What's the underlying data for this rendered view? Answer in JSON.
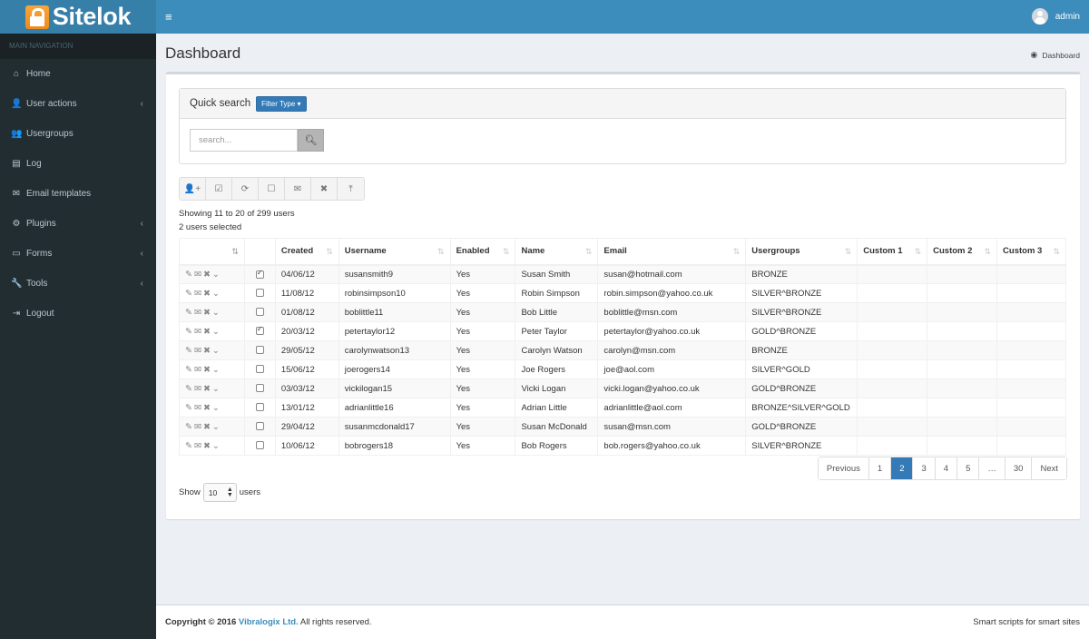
{
  "app": {
    "logo_text": "Sitelok",
    "user": "admin"
  },
  "sidebar": {
    "header": "MAIN NAVIGATION",
    "items": [
      {
        "label": "Home",
        "icon": "home-icon",
        "glyph": "⌂",
        "chevron": false
      },
      {
        "label": "User actions",
        "icon": "user-icon",
        "glyph": "👤",
        "chevron": true
      },
      {
        "label": "Usergroups",
        "icon": "users-icon",
        "glyph": "👥",
        "chevron": false
      },
      {
        "label": "Log",
        "icon": "list-icon",
        "glyph": "▤",
        "chevron": false
      },
      {
        "label": "Email templates",
        "icon": "envelope-icon",
        "glyph": "✉",
        "chevron": false
      },
      {
        "label": "Plugins",
        "icon": "plug-icon",
        "glyph": "⚙",
        "chevron": true
      },
      {
        "label": "Forms",
        "icon": "form-icon",
        "glyph": "▭",
        "chevron": true
      },
      {
        "label": "Tools",
        "icon": "wrench-icon",
        "glyph": "🔧",
        "chevron": true
      },
      {
        "label": "Logout",
        "icon": "logout-icon",
        "glyph": "⇥",
        "chevron": false
      }
    ],
    "chevron_glyph": "‹"
  },
  "page": {
    "title": "Dashboard",
    "breadcrumb": "Dashboard"
  },
  "quick_search": {
    "title": "Quick search",
    "filter_label": "Filter Type ▾",
    "placeholder": "search..."
  },
  "toolbar": [
    {
      "name": "add-user-button",
      "icon": "add-user-icon",
      "glyph": "👤+"
    },
    {
      "name": "select-all-button",
      "icon": "check-square-icon",
      "glyph": "☑"
    },
    {
      "name": "refresh-button",
      "icon": "refresh-icon",
      "glyph": "⟳"
    },
    {
      "name": "deselect-button",
      "icon": "square-icon",
      "glyph": "☐"
    },
    {
      "name": "email-button",
      "icon": "envelope-icon",
      "glyph": "✉"
    },
    {
      "name": "delete-button",
      "icon": "close-icon",
      "glyph": "✖"
    },
    {
      "name": "export-button",
      "icon": "export-icon",
      "glyph": "⤒"
    }
  ],
  "status": {
    "showing": "Showing 11 to 20 of 299 users",
    "selected": "2 users selected"
  },
  "table": {
    "columns": [
      "",
      "",
      "Created",
      "Username",
      "Enabled",
      "Name",
      "Email",
      "Usergroups",
      "Custom 1",
      "Custom 2",
      "Custom 3"
    ],
    "rows": [
      {
        "checked": true,
        "created": "04/06/12",
        "username": "susansmith9",
        "enabled": "Yes",
        "name": "Susan Smith",
        "email": "susan@hotmail.com",
        "groups": "BRONZE",
        "c1": "",
        "c2": "",
        "c3": ""
      },
      {
        "checked": false,
        "created": "11/08/12",
        "username": "robinsimpson10",
        "enabled": "Yes",
        "name": "Robin Simpson",
        "email": "robin.simpson@yahoo.co.uk",
        "groups": "SILVER^BRONZE",
        "c1": "",
        "c2": "",
        "c3": ""
      },
      {
        "checked": false,
        "created": "01/08/12",
        "username": "boblittle11",
        "enabled": "Yes",
        "name": "Bob Little",
        "email": "boblittle@msn.com",
        "groups": "SILVER^BRONZE",
        "c1": "",
        "c2": "",
        "c3": ""
      },
      {
        "checked": true,
        "created": "20/03/12",
        "username": "petertaylor12",
        "enabled": "Yes",
        "name": "Peter Taylor",
        "email": "petertaylor@yahoo.co.uk",
        "groups": "GOLD^BRONZE",
        "c1": "",
        "c2": "",
        "c3": ""
      },
      {
        "checked": false,
        "created": "29/05/12",
        "username": "carolynwatson13",
        "enabled": "Yes",
        "name": "Carolyn Watson",
        "email": "carolyn@msn.com",
        "groups": "BRONZE",
        "c1": "",
        "c2": "",
        "c3": ""
      },
      {
        "checked": false,
        "created": "15/06/12",
        "username": "joerogers14",
        "enabled": "Yes",
        "name": "Joe Rogers",
        "email": "joe@aol.com",
        "groups": "SILVER^GOLD",
        "c1": "",
        "c2": "",
        "c3": ""
      },
      {
        "checked": false,
        "created": "03/03/12",
        "username": "vickilogan15",
        "enabled": "Yes",
        "name": "Vicki Logan",
        "email": "vicki.logan@yahoo.co.uk",
        "groups": "GOLD^BRONZE",
        "c1": "",
        "c2": "",
        "c3": ""
      },
      {
        "checked": false,
        "created": "13/01/12",
        "username": "adrianlittle16",
        "enabled": "Yes",
        "name": "Adrian Little",
        "email": "adrianlittle@aol.com",
        "groups": "BRONZE^SILVER^GOLD",
        "c1": "",
        "c2": "",
        "c3": ""
      },
      {
        "checked": false,
        "created": "29/04/12",
        "username": "susanmcdonald17",
        "enabled": "Yes",
        "name": "Susan McDonald",
        "email": "susan@msn.com",
        "groups": "GOLD^BRONZE",
        "c1": "",
        "c2": "",
        "c3": ""
      },
      {
        "checked": false,
        "created": "10/06/12",
        "username": "bobrogers18",
        "enabled": "Yes",
        "name": "Bob Rogers",
        "email": "bob.rogers@yahoo.co.uk",
        "groups": "SILVER^BRONZE",
        "c1": "",
        "c2": "",
        "c3": ""
      }
    ]
  },
  "pagination": {
    "pages": [
      "Previous",
      "1",
      "2",
      "3",
      "4",
      "5",
      "…",
      "30",
      "Next"
    ],
    "active": "2"
  },
  "page_size": {
    "label_before": "Show",
    "value": "10",
    "label_after": "users"
  },
  "footer": {
    "copyright_prefix": "Copyright © 2016",
    "company": "Vibralogix Ltd.",
    "rights": "All rights reserved.",
    "tagline": "Smart scripts for smart sites"
  },
  "colors": {
    "brand": "#3c8dbc",
    "sidebar": "#222d32",
    "accent": "#337ab7",
    "logo": "#f39c12"
  }
}
